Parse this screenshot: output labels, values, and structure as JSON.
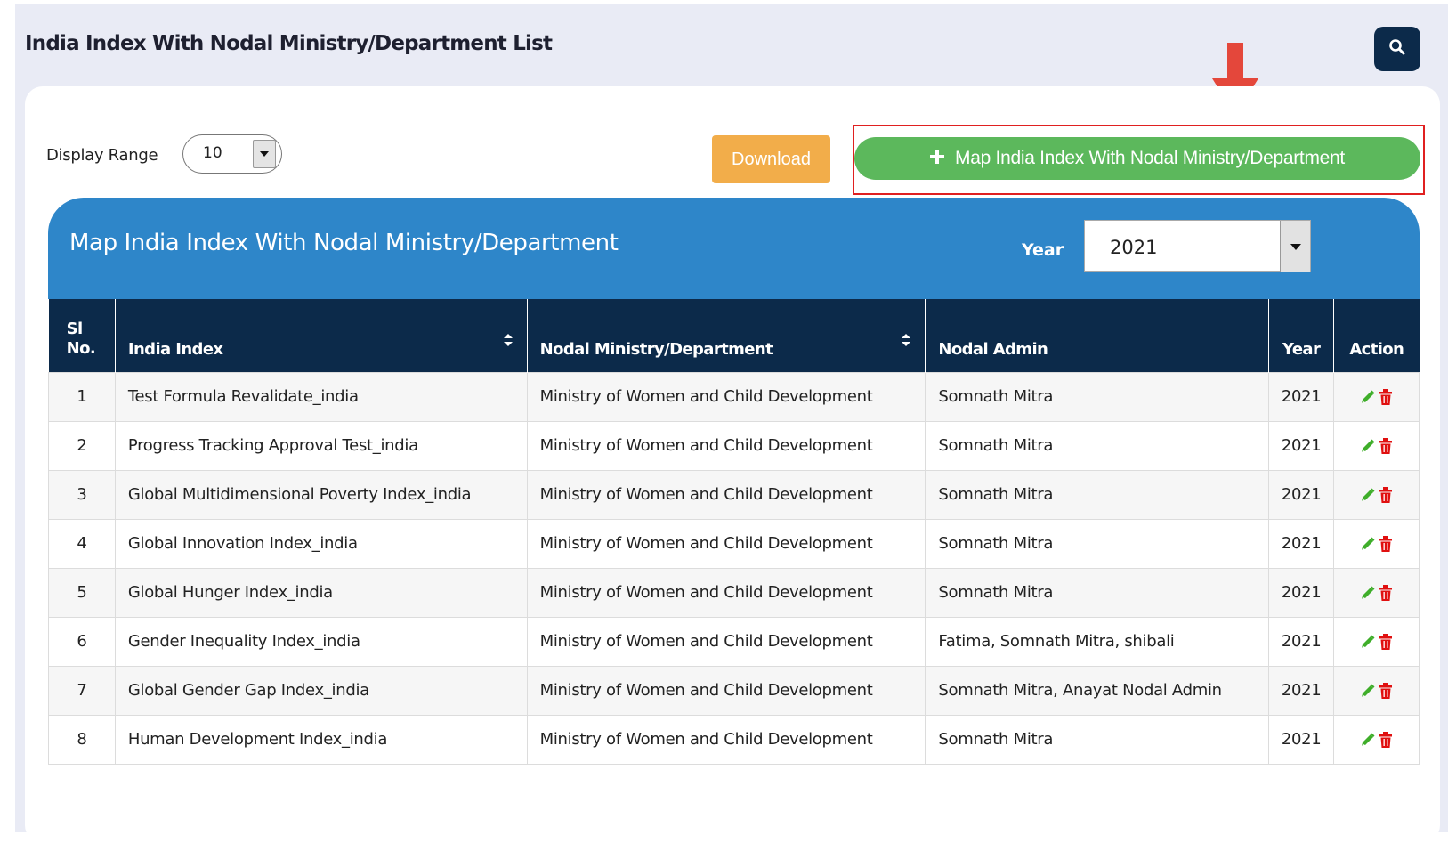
{
  "page": {
    "title": "India Index With Nodal Ministry/Department List"
  },
  "toolbar": {
    "display_range_label": "Display Range",
    "display_range_value": "10",
    "download_label": "Download",
    "map_button_label": "Map India Index With Nodal Ministry/Department"
  },
  "panel": {
    "title": "Map India Index With Nodal Ministry/Department",
    "year_label": "Year",
    "year_value": "2021"
  },
  "table": {
    "columns": [
      "Sl No.",
      "India Index",
      "Nodal Ministry/Department",
      "Nodal Admin",
      "Year",
      "Action"
    ],
    "rows": [
      {
        "sl": "1",
        "index": "Test Formula Revalidate_india",
        "ministry": "Ministry of Women and Child Development",
        "admin": "Somnath Mitra",
        "year": "2021"
      },
      {
        "sl": "2",
        "index": "Progress Tracking Approval Test_india",
        "ministry": "Ministry of Women and Child Development",
        "admin": "Somnath Mitra",
        "year": "2021"
      },
      {
        "sl": "3",
        "index": "Global Multidimensional Poverty Index_india",
        "ministry": "Ministry of Women and Child Development",
        "admin": "Somnath Mitra",
        "year": "2021"
      },
      {
        "sl": "4",
        "index": "Global Innovation Index_india",
        "ministry": "Ministry of Women and Child Development",
        "admin": "Somnath Mitra",
        "year": "2021"
      },
      {
        "sl": "5",
        "index": "Global Hunger Index_india",
        "ministry": "Ministry of Women and Child Development",
        "admin": "Somnath Mitra",
        "year": "2021"
      },
      {
        "sl": "6",
        "index": "Gender Inequality Index_india",
        "ministry": "Ministry of Women and Child Development",
        "admin": "Fatima, Somnath Mitra, shibali",
        "year": "2021"
      },
      {
        "sl": "7",
        "index": "Global Gender Gap Index_india",
        "ministry": "Ministry of Women and Child Development",
        "admin": "Somnath Mitra, Anayat Nodal Admin",
        "year": "2021"
      },
      {
        "sl": "8",
        "index": "Human Development Index_india",
        "ministry": "Ministry of Women and Child Development",
        "admin": "Somnath Mitra",
        "year": "2021"
      }
    ]
  },
  "icons": {
    "search": "search-icon",
    "edit": "pencil-icon",
    "delete": "trash-icon",
    "sort": "sort-icon",
    "plus": "plus-icon",
    "dropdown": "caret-down-icon",
    "annotation": "red-arrow-down-icon"
  },
  "colors": {
    "navy": "#0c2a4a",
    "panel_blue": "#2e86c9",
    "download_orange": "#f2ad4a",
    "map_green": "#5cb85c",
    "highlight_red": "#e02020",
    "edit_green": "#3fae2a",
    "delete_red": "#e01010"
  }
}
